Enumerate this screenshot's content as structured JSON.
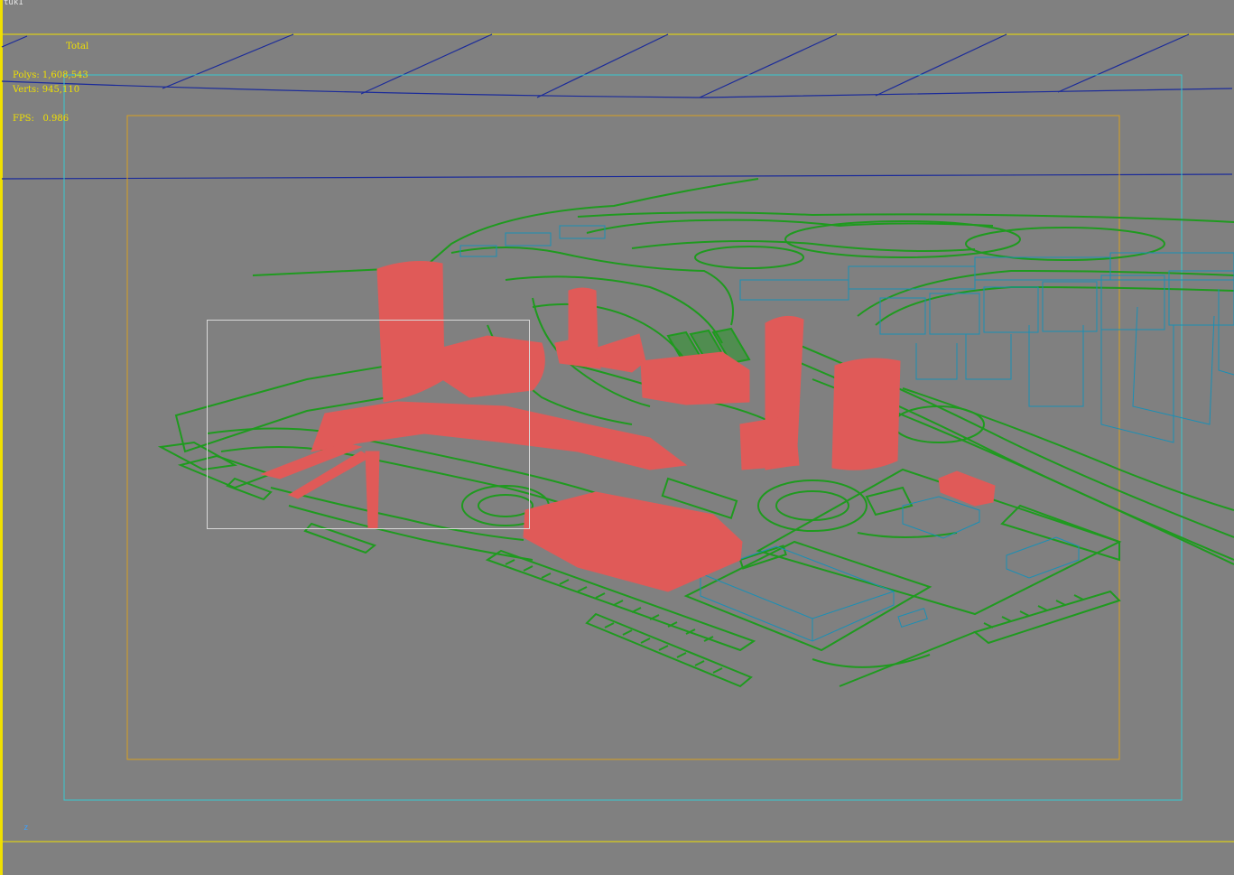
{
  "viewport": {
    "label": "tuk1",
    "axis_label": "z"
  },
  "stats": {
    "header": "Total",
    "polys_label": "Polys:",
    "polys_value": "1,608,543",
    "verts_label": "Verts:",
    "verts_value": "945,110",
    "fps_label": "FPS:",
    "fps_value": "0.986"
  },
  "colors": {
    "background": "#808080",
    "stats_text": "#f0e000",
    "safe_frame_outer": "#38c8d0",
    "safe_frame_inner": "#d8a020",
    "wireframe_terrain": "#1f9a1f",
    "wireframe_buildings": "#1a8fb5",
    "selected_mesh": "#e05a58",
    "selection_box": "#d8d8d8",
    "horizon_line": "#1a2a9a",
    "viewport_border_active": "#f0e000"
  }
}
